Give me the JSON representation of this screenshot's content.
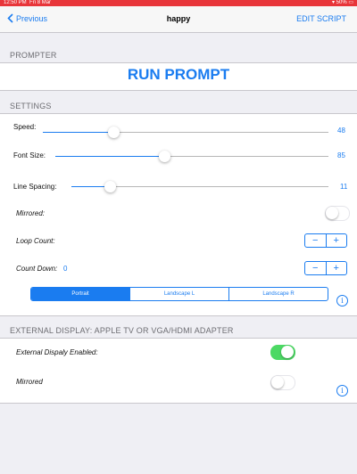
{
  "status_bar": {
    "time": "12:50 PM",
    "date": "Fri 8 Mar",
    "battery": "50%"
  },
  "nav": {
    "back_label": "Previous",
    "title": "happy",
    "edit_label": "EDIT SCRIPT"
  },
  "prompter": {
    "header": "PROMPTER",
    "run_label": "RUN PROMPT"
  },
  "settings": {
    "header": "SETTINGS",
    "speed": {
      "label": "Speed:",
      "value": "48",
      "level": 0.25
    },
    "font_size": {
      "label": "Font Size:",
      "value": "85",
      "level": 0.38
    },
    "line_spacing": {
      "label": "Line Spacing:",
      "value": "11",
      "level": 0.15
    },
    "mirrored": {
      "label": "Mirrored:",
      "on": false
    },
    "loop_count": {
      "label": "Loop Count:",
      "minus": "−",
      "plus": "+"
    },
    "count_down": {
      "label": "Count Down:",
      "value": "0",
      "minus": "−",
      "plus": "+"
    },
    "orientation": {
      "options": [
        "Portrait",
        "Landscape L",
        "Landscape R"
      ],
      "selected": "Portrait"
    },
    "info_icon": "i"
  },
  "external": {
    "header": "EXTERNAL DISPLAY: APPLE TV OR VGA/HDMI ADAPTER",
    "enabled": {
      "label": "External Dispaly Enabled:",
      "on": true
    },
    "mirrored": {
      "label": "Mirrored",
      "on": false
    },
    "info_icon": "i"
  },
  "colors": {
    "accent": "#1a7cf0",
    "status_bar": "#e8353a",
    "toggle_on": "#4cd964"
  }
}
